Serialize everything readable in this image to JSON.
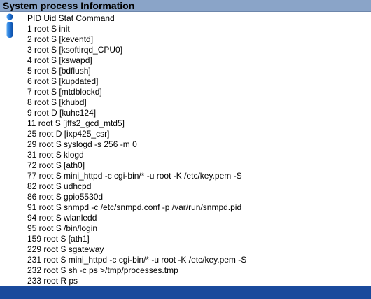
{
  "header": {
    "title": "System process Information"
  },
  "table": {
    "header_line": "PID Uid Stat Command",
    "rows": [
      "1 root S init",
      "2 root S [keventd]",
      "3 root S [ksoftirqd_CPU0]",
      "4 root S [kswapd]",
      "5 root S [bdflush]",
      "6 root S [kupdated]",
      "7 root S [mtdblockd]",
      "8 root S [khubd]",
      "9 root D [kuhc124]",
      "11 root S [jffs2_gcd_mtd5]",
      "25 root D [ixp425_csr]",
      "29 root S syslogd -s 256 -m 0",
      "31 root S klogd",
      "72 root S [ath0]",
      "77 root S mini_httpd -c cgi-bin/* -u root -K /etc/key.pem -S",
      "82 root S udhcpd",
      "86 root S gpio5530d",
      "91 root S snmpd -c /etc/snmpd.conf -p /var/run/snmpd.pid",
      "94 root S wlanledd",
      "95 root S /bin/login",
      "159 root S [ath1]",
      "229 root S sgateway",
      "231 root S mini_httpd -c cgi-bin/* -u root -K /etc/key.pem -S",
      "232 root S sh -c ps >/tmp/processes.tmp",
      "233 root R ps"
    ]
  },
  "icons": {
    "info": "info-person-icon"
  },
  "colors": {
    "title_bar": "#8aa4c8",
    "footer_bar": "#1a4a9c",
    "icon_blue": "#1e73d6"
  }
}
